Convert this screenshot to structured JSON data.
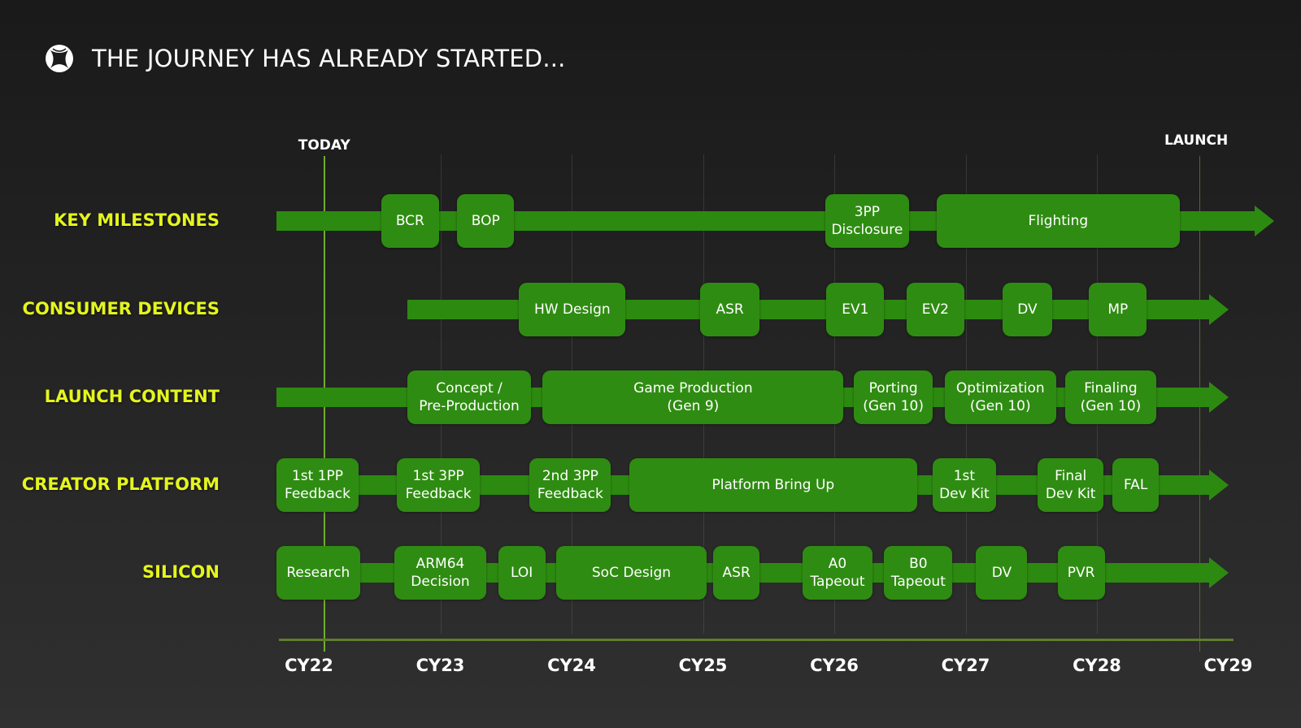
{
  "header": {
    "logo_icon": "xbox-logo-icon",
    "title": "THE JOURNEY HAS ALREADY STARTED..."
  },
  "markers": {
    "today": {
      "label": "TODAY",
      "year": 22.11
    },
    "launch": {
      "label": "LAUNCH",
      "year": 28.78
    }
  },
  "timeline": {
    "axis_start_year": 22,
    "axis_end_year": 29,
    "years": [
      "CY22",
      "CY23",
      "CY24",
      "CY25",
      "CY26",
      "CY27",
      "CY28",
      "CY29"
    ]
  },
  "colors": {
    "lane_green": "#2d8a10",
    "box_green": "#2f8c12",
    "row_label": "#e4f51e",
    "text": "#ffffff",
    "marker_line": "#6fae2a"
  },
  "lanes": [
    {
      "label": "KEY MILESTONES",
      "bar_start": 21.75,
      "bar_end": 29.35,
      "items": [
        {
          "label": "BCR",
          "start": 22.55,
          "end": 22.99
        },
        {
          "label": "BOP",
          "start": 23.13,
          "end": 23.56
        },
        {
          "label": "3PP\nDisclosure",
          "start": 25.93,
          "end": 26.57
        },
        {
          "label": "Flighting",
          "start": 26.78,
          "end": 28.63
        }
      ]
    },
    {
      "label": "CONSUMER DEVICES",
      "bar_start": 22.75,
      "bar_end": 29.0,
      "items": [
        {
          "label": "HW Design",
          "start": 23.6,
          "end": 24.41
        },
        {
          "label": "ASR",
          "start": 24.98,
          "end": 25.43
        },
        {
          "label": "EV1",
          "start": 25.94,
          "end": 26.38
        },
        {
          "label": "EV2",
          "start": 26.55,
          "end": 26.99
        },
        {
          "label": "DV",
          "start": 27.28,
          "end": 27.66
        },
        {
          "label": "MP",
          "start": 27.94,
          "end": 28.38
        }
      ]
    },
    {
      "label": "LAUNCH CONTENT",
      "bar_start": 21.75,
      "bar_end": 29.0,
      "items": [
        {
          "label": "Concept /\nPre-Production",
          "start": 22.75,
          "end": 23.69
        },
        {
          "label": "Game Production\n(Gen 9)",
          "start": 23.78,
          "end": 26.07
        },
        {
          "label": "Porting\n(Gen 10)",
          "start": 26.15,
          "end": 26.75
        },
        {
          "label": "Optimization\n(Gen 10)",
          "start": 26.84,
          "end": 27.69
        },
        {
          "label": "Finaling\n(Gen 10)",
          "start": 27.76,
          "end": 28.45
        }
      ]
    },
    {
      "label": "CREATOR PLATFORM",
      "bar_start": 21.75,
      "bar_end": 29.0,
      "items": [
        {
          "label": "1st 1PP\nFeedback",
          "start": 21.75,
          "end": 22.38
        },
        {
          "label": "1st 3PP\nFeedback",
          "start": 22.67,
          "end": 23.3
        },
        {
          "label": "2nd 3PP\nFeedback",
          "start": 23.68,
          "end": 24.3
        },
        {
          "label": "Platform Bring Up",
          "start": 24.44,
          "end": 26.63
        },
        {
          "label": "1st\nDev Kit",
          "start": 26.75,
          "end": 27.23
        },
        {
          "label": "Final\nDev Kit",
          "start": 27.55,
          "end": 28.05
        },
        {
          "label": "FAL",
          "start": 28.12,
          "end": 28.47
        }
      ]
    },
    {
      "label": "SILICON",
      "bar_start": 21.75,
      "bar_end": 29.0,
      "items": [
        {
          "label": "Research",
          "start": 21.75,
          "end": 22.39
        },
        {
          "label": "ARM64\nDecision",
          "start": 22.65,
          "end": 23.35
        },
        {
          "label": "LOI",
          "start": 23.44,
          "end": 23.8
        },
        {
          "label": "SoC Design",
          "start": 23.88,
          "end": 25.03
        },
        {
          "label": "ASR",
          "start": 25.08,
          "end": 25.43
        },
        {
          "label": "A0\nTapeout",
          "start": 25.76,
          "end": 26.29
        },
        {
          "label": "B0\nTapeout",
          "start": 26.38,
          "end": 26.9
        },
        {
          "label": "DV",
          "start": 27.08,
          "end": 27.47
        },
        {
          "label": "PVR",
          "start": 27.7,
          "end": 28.06
        }
      ]
    }
  ]
}
